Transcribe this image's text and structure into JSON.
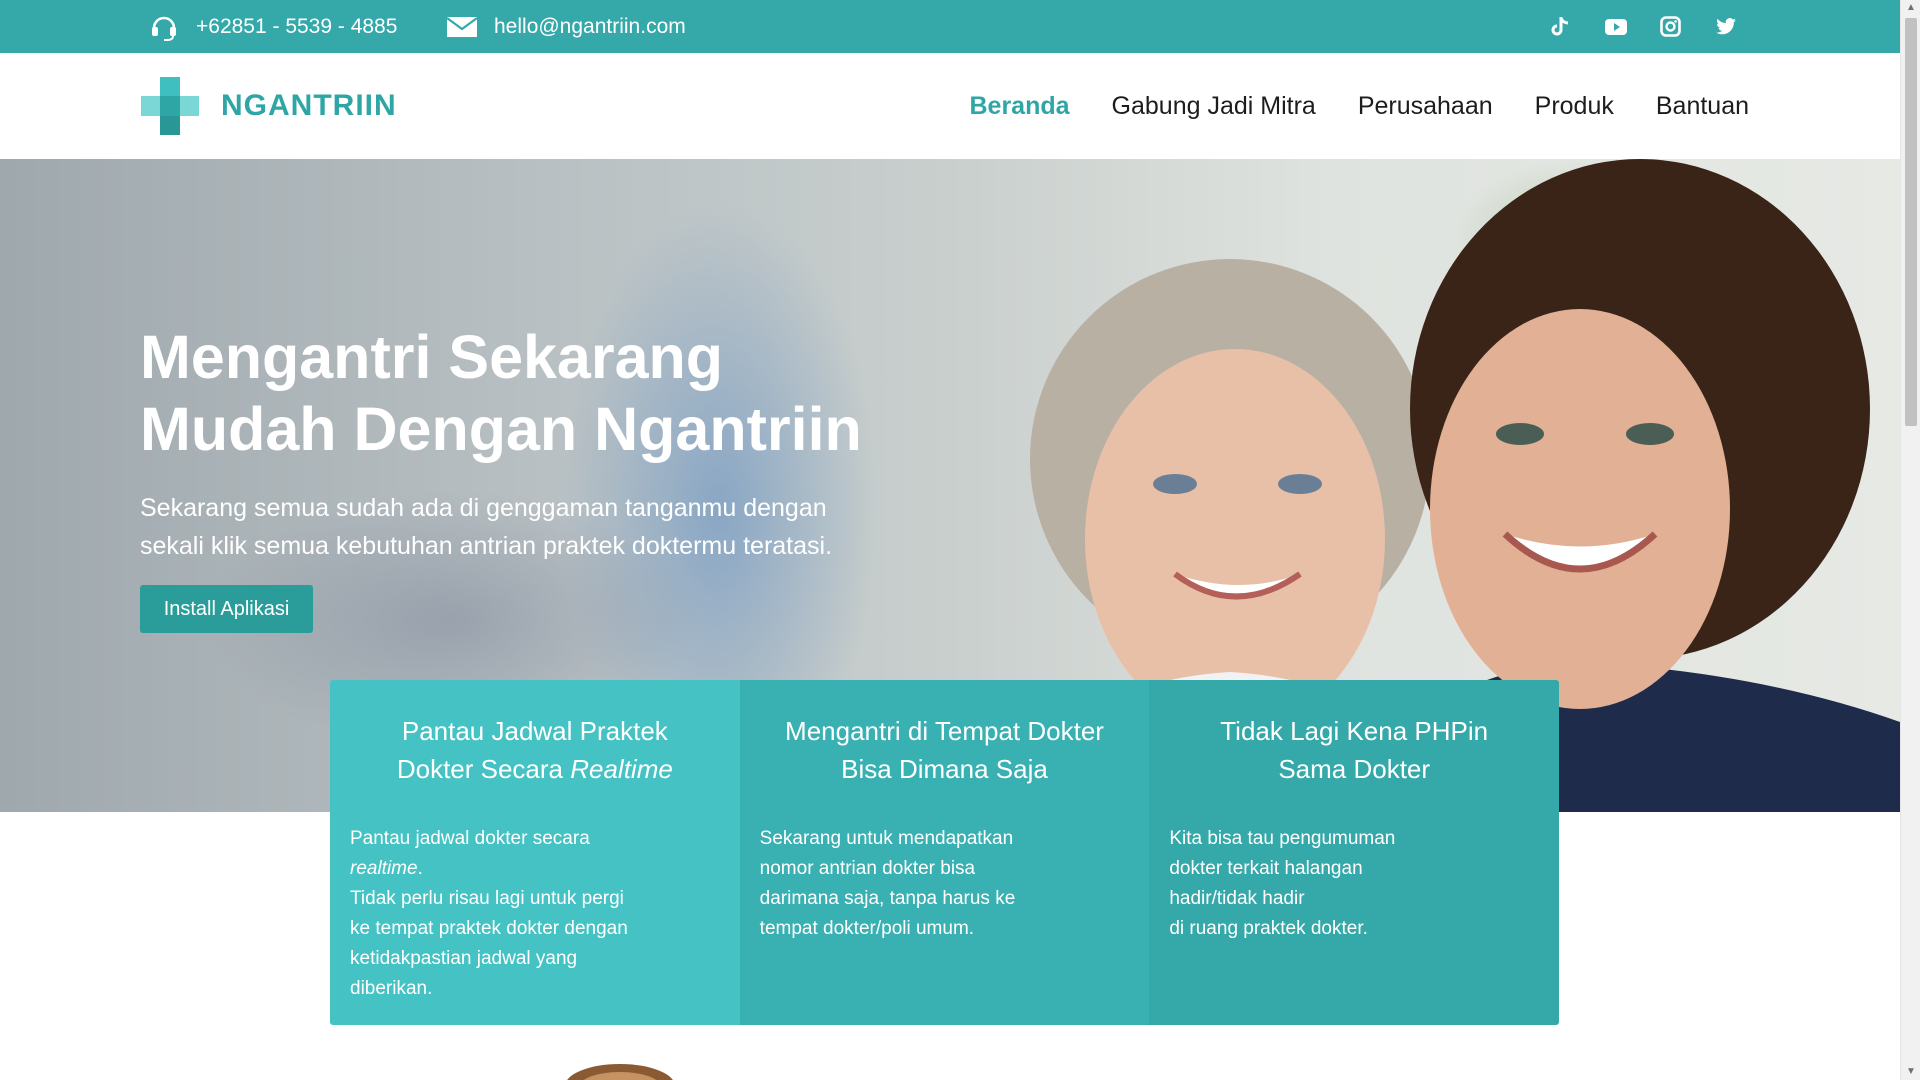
{
  "topbar": {
    "phone": "+62851 - 5539 - 4885",
    "email": "hello@ngantriin.com",
    "social_icons": [
      "tiktok-icon",
      "youtube-icon",
      "instagram-icon",
      "twitter-icon"
    ]
  },
  "brand": {
    "name": "NGANTRIIN",
    "color": "#2fa6a6"
  },
  "nav": {
    "items": [
      {
        "label": "Beranda",
        "active": true
      },
      {
        "label": "Gabung Jadi Mitra",
        "active": false
      },
      {
        "label": "Perusahaan",
        "active": false
      },
      {
        "label": "Produk",
        "active": false
      },
      {
        "label": "Bantuan",
        "active": false
      }
    ]
  },
  "hero": {
    "title_line1": "Mengantri Sekarang",
    "title_line2": "Mudah Dengan Ngantriin",
    "subtitle_line1": "Sekarang semua sudah ada di genggaman tanganmu dengan",
    "subtitle_line2": "sekali klik semua kebutuhan antrian praktek doktermu teratasi.",
    "cta_label": "Install Aplikasi"
  },
  "features": [
    {
      "title_line1": "Pantau Jadwal Praktek",
      "title_line2_prefix": "Dokter Secara ",
      "title_line2_em": "Realtime",
      "body_line1": "Pantau jadwal dokter secara",
      "body_em": "realtime",
      "body_rest": "Tidak perlu risau lagi untuk pergi\nke tempat praktek dokter dengan\nketidakpastian jadwal yang\ndiberikan."
    },
    {
      "title_line1": "Mengantri di Tempat Dokter",
      "title_line2": "Bisa Dimana Saja",
      "body": "Sekarang untuk mendapatkan\nnomor antrian dokter bisa\ndarimana saja, tanpa harus ke\ntempat dokter/poli umum."
    },
    {
      "title_line1": "Tidak Lagi Kena PHPin",
      "title_line2": "Sama Dokter",
      "body": "Kita bisa tau pengumuman\ndokter terkait halangan\nhadir/tidak hadir\ndi ruang praktek dokter."
    }
  ],
  "colors": {
    "teal_primary": "#35a8a9",
    "teal_button": "#2a9d9b",
    "card1": "#45c2c3",
    "card2": "#39b0b2",
    "card3": "#35a8a9"
  }
}
